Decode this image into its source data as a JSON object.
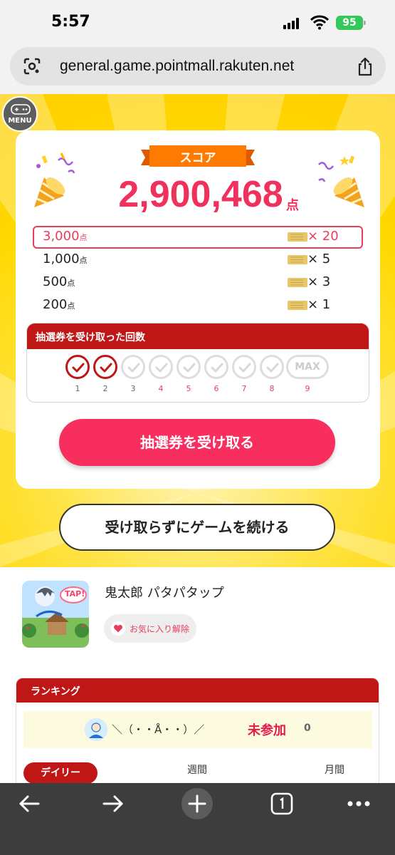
{
  "status_bar": {
    "time": "5:57",
    "battery": "95"
  },
  "browser": {
    "url": "general.game.pointmall.rakuten.net"
  },
  "game": {
    "menu_label": "MENU",
    "score_label": "スコア",
    "score_value": "2,900,468",
    "score_unit": "点",
    "tiers": [
      {
        "points": "3,000",
        "unit": "点",
        "multiplier": "× 20",
        "active": true
      },
      {
        "points": "1,000",
        "unit": "点",
        "multiplier": "× 5",
        "active": false
      },
      {
        "points": "500",
        "unit": "点",
        "multiplier": "× 3",
        "active": false
      },
      {
        "points": "200",
        "unit": "点",
        "multiplier": "× 1",
        "active": false
      }
    ],
    "count_title": "抽選券を受け取った回数",
    "count_steps": [
      "1",
      "2",
      "3",
      "4",
      "5",
      "6",
      "7",
      "8",
      "9"
    ],
    "max_label": "MAX",
    "completed_steps": 2,
    "receive_button": "抽選券を受け取る",
    "continue_button": "受け取らずにゲームを続ける"
  },
  "game_info": {
    "title": "鬼太郎 パタパタップ",
    "thumb_badge": "TAP!",
    "favorite_button": "お気に入り解除"
  },
  "ranking": {
    "title": "ランキング",
    "nickname": "＼（・・Å・・）／",
    "status": "未参加",
    "count": "0",
    "tabs": [
      "デイリー",
      "週間",
      "月間"
    ]
  },
  "colors": {
    "accent": "#f72e5e",
    "header_red": "#bf1616",
    "yellow": "#ffd800"
  }
}
